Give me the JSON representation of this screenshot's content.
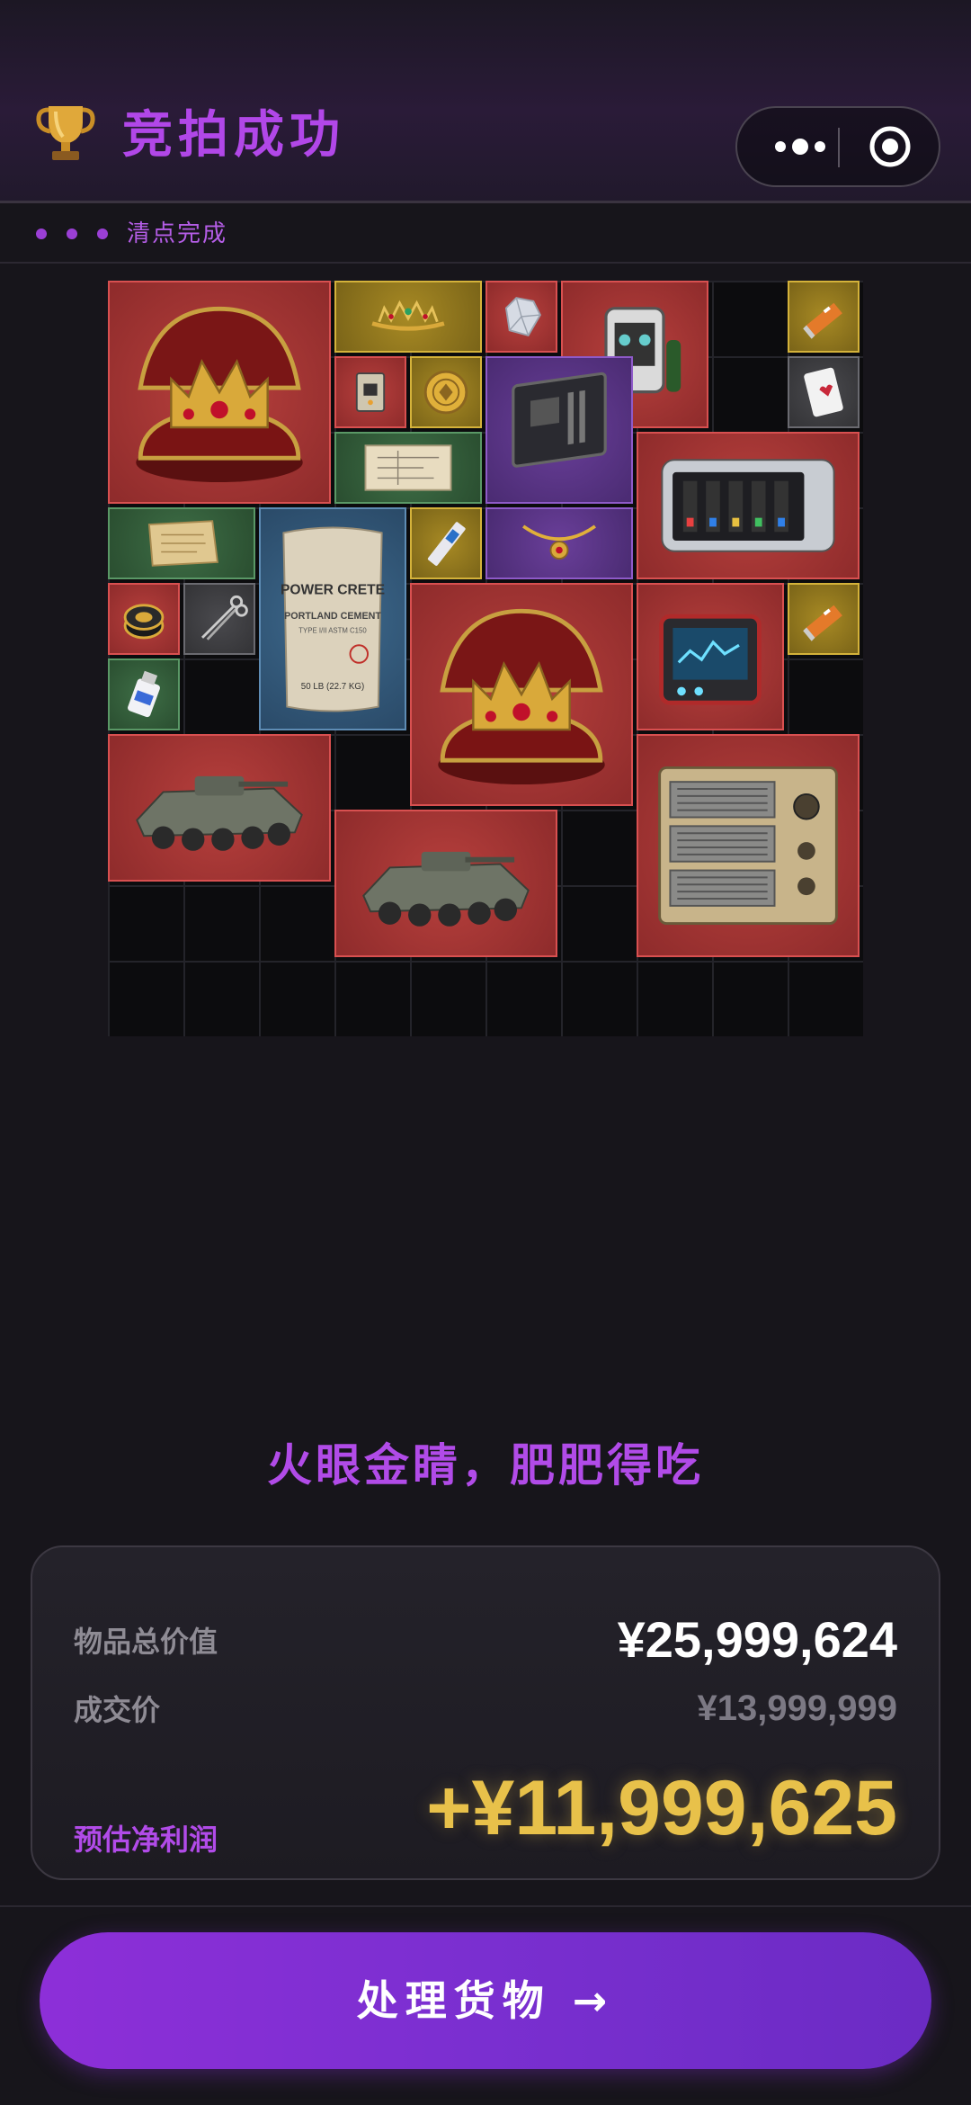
{
  "header": {
    "title": "竞拍成功",
    "trophy_icon": "trophy-icon",
    "menu_icon": "more-dots-icon",
    "close_icon": "target-circle-icon"
  },
  "status": {
    "text": "清点完成",
    "dot_color": "#9b3fd6"
  },
  "inventory": {
    "rarity_colors": {
      "red": "#b8403d",
      "gold": "#a88a24",
      "purple": "#6a3f9a",
      "blue": "#3e6a8e",
      "green": "#3e6e46",
      "gray": "#4a4a4e"
    },
    "items": [
      {
        "name": "crown-in-case",
        "rarity": "red"
      },
      {
        "name": "gold-tiara",
        "rarity": "gold"
      },
      {
        "name": "diamond",
        "rarity": "red"
      },
      {
        "name": "scuba-rebreather",
        "rarity": "red"
      },
      {
        "name": "orange-card-pack",
        "rarity": "gold"
      },
      {
        "name": "circuit-module",
        "rarity": "red"
      },
      {
        "name": "gold-coin",
        "rarity": "gold"
      },
      {
        "name": "motherboard",
        "rarity": "purple"
      },
      {
        "name": "playing-card",
        "rarity": "gray"
      },
      {
        "name": "blueprint",
        "rarity": "green"
      },
      {
        "name": "server-storage",
        "rarity": "red"
      },
      {
        "name": "old-paper",
        "rarity": "green"
      },
      {
        "name": "cement-bag",
        "rarity": "blue"
      },
      {
        "name": "ssd-drive",
        "rarity": "gold"
      },
      {
        "name": "gold-necklace",
        "rarity": "purple"
      },
      {
        "name": "lighter",
        "rarity": "red"
      },
      {
        "name": "surgical-scissors",
        "rarity": "gray"
      },
      {
        "name": "crown-in-case",
        "rarity": "red"
      },
      {
        "name": "field-monitor",
        "rarity": "red"
      },
      {
        "name": "orange-card-pack",
        "rarity": "gold"
      },
      {
        "name": "medicine-bottle",
        "rarity": "green"
      },
      {
        "name": "armored-vehicle",
        "rarity": "red"
      },
      {
        "name": "armored-vehicle",
        "rarity": "red"
      },
      {
        "name": "military-power-unit",
        "rarity": "red"
      }
    ],
    "cement_text": {
      "l1": "POWER CRETE",
      "l2": "PORTLAND CEMENT",
      "l3": "TYPE I/II ASTM C150",
      "l4": "50 LB (22.7 KG)"
    }
  },
  "slogan": "火眼金睛，肥肥得吃",
  "summary": {
    "total_label": "物品总价值",
    "total_value": "¥25,999,624",
    "price_label": "成交价",
    "price_value": "¥13,999,999",
    "profit_label": "预估净利润",
    "profit_value": "+¥11,999,625",
    "profit_color": "#e8c14a",
    "accent_color": "#b14be8"
  },
  "cta": {
    "label": "处理货物 →"
  }
}
